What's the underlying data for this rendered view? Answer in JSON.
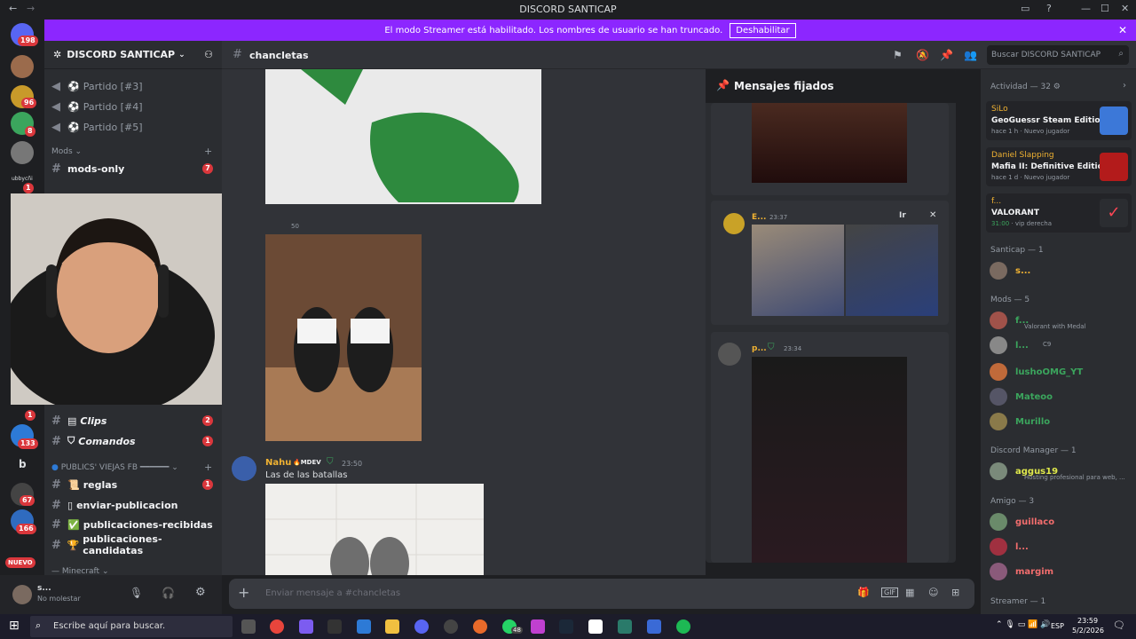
{
  "window": {
    "title": "DISCORD SANTICAP",
    "min": "—",
    "max": "☐",
    "close": "✕"
  },
  "banner": {
    "text": "El modo Streamer está habilitado. Los nombres de usuario se han truncado.",
    "button": "Deshabilitar"
  },
  "server_list": {
    "badges": [
      "198",
      "96",
      "8",
      "1",
      "1",
      "133",
      "67",
      "166"
    ],
    "dm_label": "ubbycñi",
    "new_label": "NUEVO",
    "letter": "b"
  },
  "guild": {
    "name": "DISCORD SANTICAP"
  },
  "channels": {
    "voice": [
      "Partido [#3]",
      "Partido [#4]",
      "Partido [#5]"
    ],
    "mods_category": "Mods",
    "mods_only": "mods-only",
    "mods_only_badge": "7",
    "clips": "Clips",
    "clips_badge": "2",
    "comandos": "Comandos",
    "comandos_badge": "1",
    "publics_category": "PUBLICS' VIEJAS FB ━━━━━━",
    "reglas": "reglas",
    "reglas_badge": "1",
    "enviar": "enviar-publicacion",
    "recibidas": "publicaciones-recibidas",
    "candidatas": "publicaciones-candidatas",
    "minecraft_category": "Minecraft"
  },
  "user": {
    "name": "s...",
    "status": "No molestar"
  },
  "chat": {
    "channel": "chancletas",
    "timestamp_partial": "50",
    "msg_author": "Nahu",
    "msg_tag": "MDEV",
    "msg_time": "23:50",
    "msg_text": "Las de las batallas",
    "composer_placeholder": "Enviar mensaje a #chancletas"
  },
  "search": {
    "placeholder": "Buscar DISCORD SANTICAP"
  },
  "pinned": {
    "title": "Mensajes fijados",
    "msg1_author": "E...",
    "msg1_time": "23:37",
    "msg1_jump": "Ir",
    "msg2_author": "p...",
    "msg2_time": "23:34"
  },
  "members": {
    "activity_header": "Actividad — 32",
    "activities": [
      {
        "user": "SiLo",
        "game": "GeoGuessr Steam Edition",
        "meta": "hace 1 h",
        "extra": "Nuevo jugador"
      },
      {
        "user": "Daniel Slapping",
        "game": "Mafia II: Definitive Edition",
        "meta": "hace 1 d",
        "extra": "Nuevo jugador"
      },
      {
        "user": "f...",
        "game": "VALORANT",
        "meta": "31:00",
        "extra": "vip derecha"
      }
    ],
    "santicap_header": "Santicap — 1",
    "santicap": "s...",
    "mods_header": "Mods — 5",
    "mods": [
      {
        "name": "f...",
        "status": "Valorant with Medal"
      },
      {
        "name": "l...",
        "status": "C9"
      },
      {
        "name": "lushoOMG_YT",
        "status": ""
      },
      {
        "name": "Mateoo",
        "status": ""
      },
      {
        "name": "Murillo",
        "status": ""
      }
    ],
    "manager_header": "Discord Manager — 1",
    "manager": {
      "name": "aggus19",
      "status": "Hosting profesional para web, ..."
    },
    "friend_header": "Amigo — 3",
    "friends": [
      "guillaco",
      "l...",
      "margim"
    ],
    "streamer_header": "Streamer — 1"
  },
  "taskbar": {
    "search": "Escribe aquí para buscar.",
    "time": "23:59",
    "date": "5/2/2026",
    "lang": "ESP",
    "whatsapp_badge": "48"
  }
}
